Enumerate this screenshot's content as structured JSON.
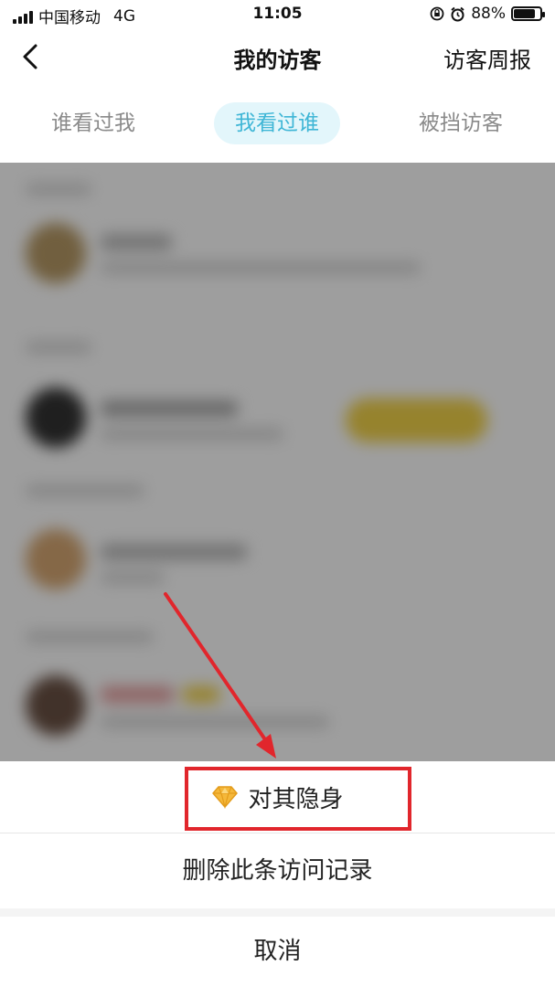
{
  "status_bar": {
    "carrier": "中国移动",
    "network": "4G",
    "time": "11:05",
    "battery": "88%",
    "battery_level": 0.88,
    "icons": [
      "signal-icon",
      "lock-rotation-icon",
      "alarm-icon",
      "battery-icon"
    ]
  },
  "nav": {
    "title": "我的访客",
    "weekly_report": "访客周报",
    "back_icon": "chevron-left-icon"
  },
  "tabs": [
    {
      "label": "谁看过我",
      "active": false
    },
    {
      "label": "我看过谁",
      "active": true
    },
    {
      "label": "被挡访客",
      "active": false
    }
  ],
  "action_sheet": {
    "invisible_label": "对其隐身",
    "invisible_icon": "diamond-icon",
    "delete_label": "删除此条访问记录",
    "cancel_label": "取消"
  },
  "colors": {
    "accent": "#3fb6d6",
    "accent_bg": "#e3f6fb",
    "annotation_red": "#e1262c",
    "diamond": "#f5b83a"
  }
}
